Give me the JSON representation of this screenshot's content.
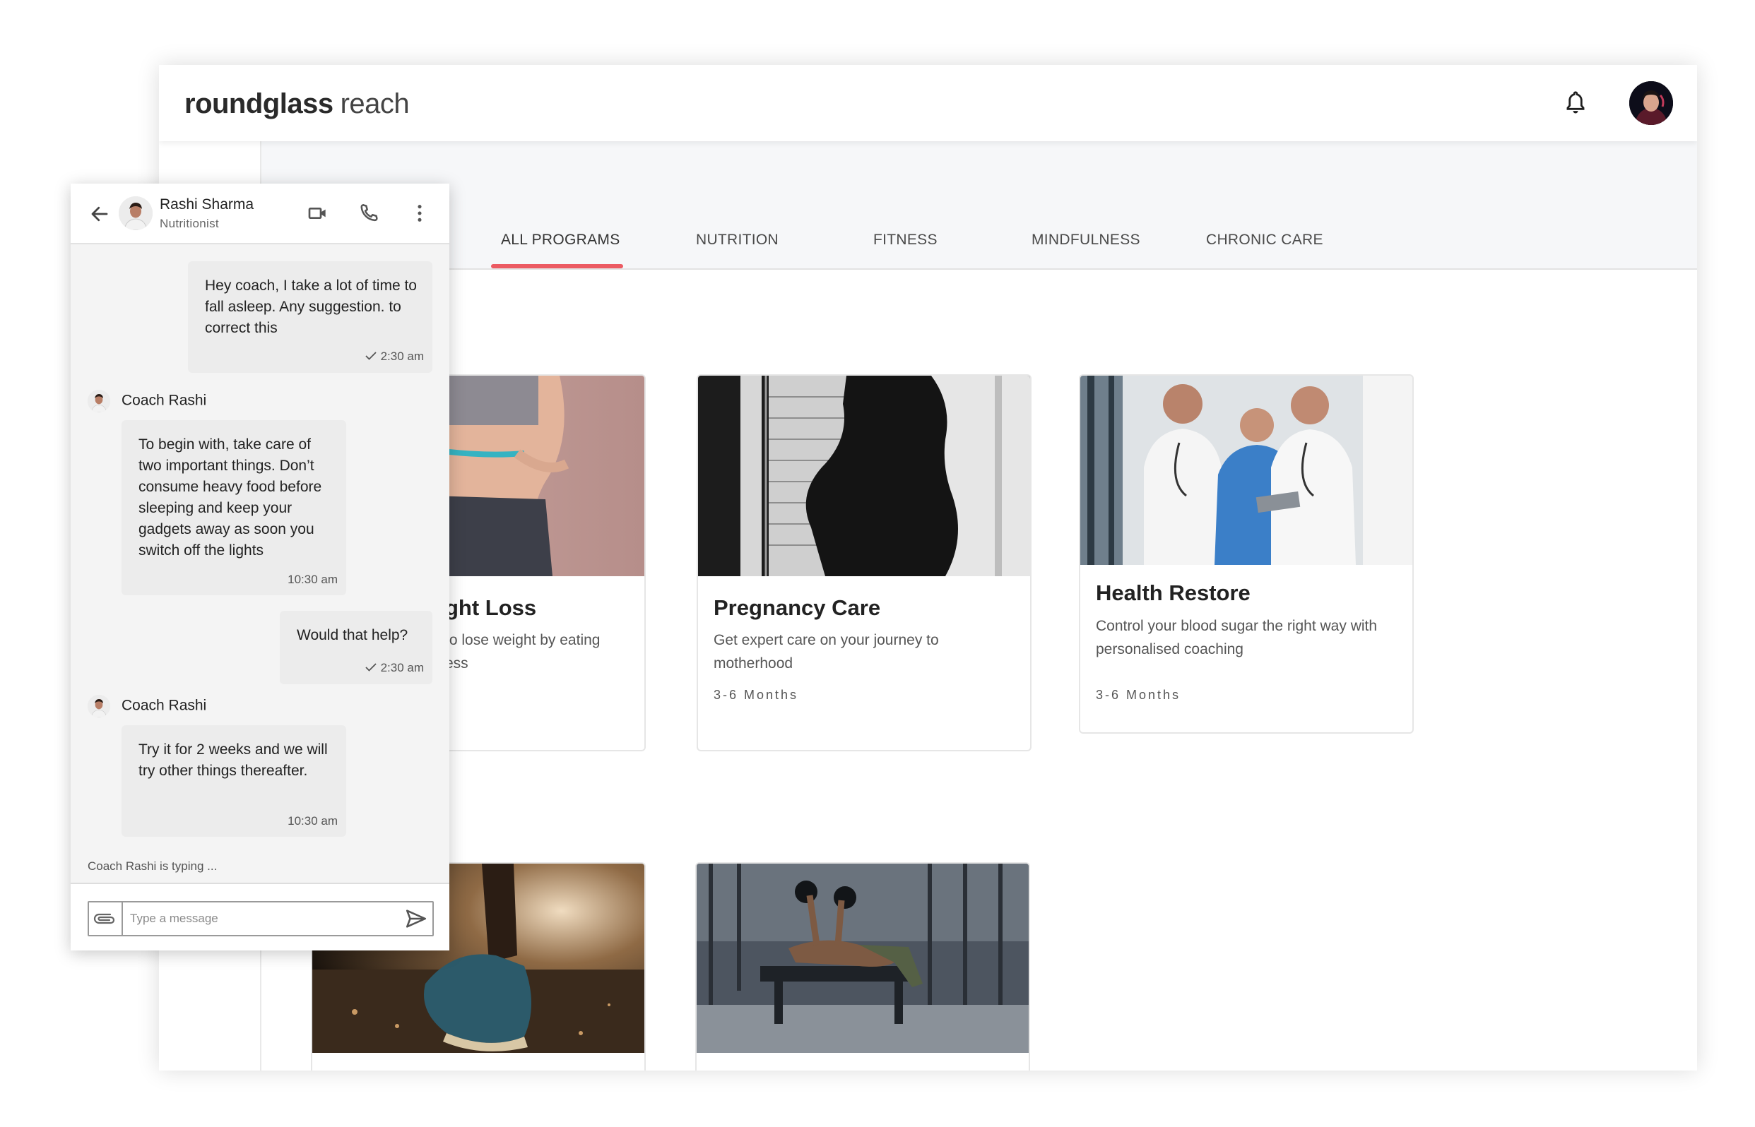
{
  "brand": {
    "name_bold": "roundglass",
    "name_light": "reach"
  },
  "header": {
    "notification_icon": "bell-icon",
    "avatar_icon": "user-avatar"
  },
  "tabs": [
    {
      "label": "ALL PROGRAMS",
      "active": true
    },
    {
      "label": "NUTRITION"
    },
    {
      "label": "FITNESS"
    },
    {
      "label": "MINDFULNESS"
    },
    {
      "label": "CHRONIC CARE"
    }
  ],
  "accent_color": "#ec5b63",
  "programs": [
    {
      "title": "ght Loss",
      "desc": "to lose weight by eating\ness",
      "duration": ""
    },
    {
      "title": "Pregnancy Care",
      "desc": "Get expert care on your journey to motherhood",
      "duration": "3-6 Months"
    },
    {
      "title": "Health Restore",
      "desc": "Control your blood sugar the right way with personalised coaching",
      "duration": "3-6 Months"
    }
  ],
  "chat": {
    "contact_name": "Rashi Sharma",
    "contact_role": "Nutritionist",
    "messages": [
      {
        "from": "user",
        "text": "Hey coach, I take a lot of time to fall asleep. Any suggestion. to correct this",
        "time": "2:30 am"
      },
      {
        "from": "coach",
        "sender": "Coach Rashi",
        "text": "To begin with, take care of two important things. Don’t consume heavy food before sleeping and keep your gadgets away as soon you switch off the lights",
        "time": "10:30 am"
      },
      {
        "from": "user",
        "text": "Would that help?",
        "time": "2:30 am"
      },
      {
        "from": "coach",
        "sender": "Coach Rashi",
        "text": "Try it for 2 weeks and we will try other things thereafter.",
        "time": "10:30 am"
      }
    ],
    "typing": "Coach Rashi is typing ...",
    "input_placeholder": "Type a message"
  }
}
